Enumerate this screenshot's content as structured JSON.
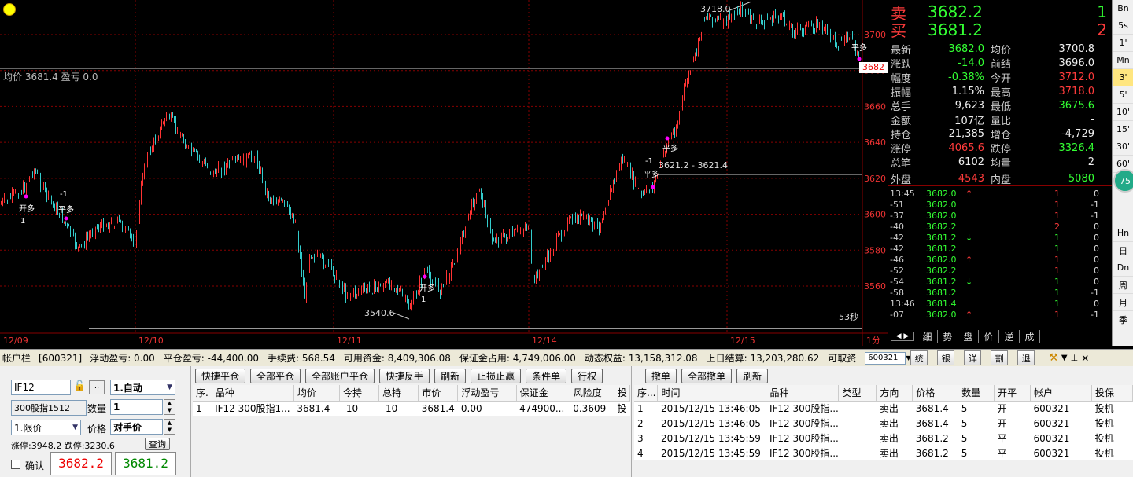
{
  "chart": {
    "price_ticks": [
      "3700",
      "3680",
      "3660",
      "3640",
      "3620",
      "3600",
      "3580",
      "3560"
    ],
    "date_ticks": [
      "12/09",
      "12/10",
      "12/11",
      "12/14",
      "12/15"
    ],
    "current_price_tag": "3682",
    "avg_label": "均价 3681.4 盈亏 0.0",
    "label_high": "3718.0",
    "label_low": "3540.6",
    "label_range": "3621.2 - 3621.4",
    "countdown": "53秒",
    "period": "1分",
    "marker_buy": "开多",
    "marker_sell": "平多",
    "marker_m1": "-1",
    "marker_p1": "1"
  },
  "quote": {
    "sell_label": "卖",
    "sell_price": "3682.2",
    "sell_qty": "1",
    "buy_label": "买",
    "buy_price": "3681.2",
    "buy_qty": "2",
    "rows": [
      {
        "l1": "最新",
        "v1": "3682.0",
        "c1": "green",
        "l2": "均价",
        "v2": "3700.8",
        "c2": "white"
      },
      {
        "l1": "涨跌",
        "v1": "-14.0",
        "c1": "green",
        "l2": "前结",
        "v2": "3696.0",
        "c2": "white"
      },
      {
        "l1": "幅度",
        "v1": "-0.38%",
        "c1": "green",
        "l2": "今开",
        "v2": "3712.0",
        "c2": "red"
      },
      {
        "l1": "振幅",
        "v1": "1.15%",
        "c1": "white",
        "l2": "最高",
        "v2": "3718.0",
        "c2": "red"
      },
      {
        "l1": "总手",
        "v1": "9,623",
        "c1": "white",
        "l2": "最低",
        "v2": "3675.6",
        "c2": "green"
      },
      {
        "l1": "金额",
        "v1": "107亿",
        "c1": "white",
        "l2": "量比",
        "v2": "-",
        "c2": "white"
      },
      {
        "l1": "持仓",
        "v1": "21,385",
        "c1": "white",
        "l2": "增仓",
        "v2": "-4,729",
        "c2": "white"
      },
      {
        "l1": "涨停",
        "v1": "4065.6",
        "c1": "red",
        "l2": "跌停",
        "v2": "3326.4",
        "c2": "green"
      },
      {
        "l1": "总笔",
        "v1": "6102",
        "c1": "white",
        "l2": "均量",
        "v2": "2",
        "c2": "white"
      }
    ],
    "outer_label": "外盘",
    "outer_val": "4543",
    "inner_label": "内盘",
    "inner_val": "5080",
    "ticks": [
      {
        "t": "13:45",
        "p": "3682.0",
        "a": "↑",
        "ac": "red",
        "q": "1",
        "qc": "red",
        "d": "0"
      },
      {
        "t": "-51",
        "p": "3682.0",
        "a": "",
        "ac": "red",
        "q": "1",
        "qc": "red",
        "d": "-1"
      },
      {
        "t": "-37",
        "p": "3682.0",
        "a": "",
        "ac": "red",
        "q": "1",
        "qc": "red",
        "d": "-1"
      },
      {
        "t": "-40",
        "p": "3682.2",
        "a": "",
        "ac": "red",
        "q": "2",
        "qc": "red",
        "d": "0"
      },
      {
        "t": "-42",
        "p": "3681.2",
        "a": "↓",
        "ac": "green",
        "q": "1",
        "qc": "green",
        "d": "0"
      },
      {
        "t": "-42",
        "p": "3681.2",
        "a": "",
        "ac": "green",
        "q": "1",
        "qc": "green",
        "d": "0"
      },
      {
        "t": "-46",
        "p": "3682.0",
        "a": "↑",
        "ac": "red",
        "q": "1",
        "qc": "red",
        "d": "0"
      },
      {
        "t": "-52",
        "p": "3682.2",
        "a": "",
        "ac": "red",
        "q": "1",
        "qc": "red",
        "d": "0"
      },
      {
        "t": "-54",
        "p": "3681.2",
        "a": "↓",
        "ac": "green",
        "q": "1",
        "qc": "green",
        "d": "0"
      },
      {
        "t": "-58",
        "p": "3681.2",
        "a": "",
        "ac": "green",
        "q": "1",
        "qc": "green",
        "d": "-1"
      },
      {
        "t": "13:46",
        "p": "3681.4",
        "a": "",
        "ac": "red",
        "q": "1",
        "qc": "green",
        "d": "0"
      },
      {
        "t": "-07",
        "p": "3682.0",
        "a": "↑",
        "ac": "red",
        "q": "1",
        "qc": "red",
        "d": "-1"
      }
    ],
    "tabs": [
      "细",
      "势",
      "盘",
      "价",
      "逆",
      "成"
    ]
  },
  "rbar": [
    "Bn",
    "5s",
    "1'",
    "Mn",
    "3'",
    "5'",
    "10'",
    "15'",
    "30'",
    "60'",
    "Hn",
    "日",
    "Dn",
    "周",
    "月",
    "季"
  ],
  "rbar_badge": "75",
  "account": {
    "label": "帐户栏",
    "id": "[600321]",
    "items": [
      "浮动盈亏: 0.00",
      "平仓盈亏: -44,400.00",
      "手续费: 568.54",
      "可用资金: 8,409,306.08",
      "保证金占用: 4,749,006.00",
      "动态权益: 13,158,312.08",
      "上日结算: 13,203,280.62",
      "可取资"
    ],
    "select": "600321",
    "btns": [
      "统",
      "银",
      "详",
      "割",
      "退"
    ]
  },
  "order": {
    "code": "IF12",
    "name": "300股指1512",
    "mode": "1.自动",
    "qty_label": "数量",
    "qty": "1",
    "type": "1.限价",
    "price_label": "价格",
    "price": "对手价",
    "query": "查询",
    "limits": "涨停:3948.2 跌停:3230.6",
    "confirm": "确认",
    "sell_price": "3682.2",
    "buy_price": "3681.2"
  },
  "pos_buttons": [
    "快捷平仓",
    "全部平仓",
    "全部账户平仓",
    "快捷反手",
    "刷新",
    "止损止赢",
    "条件单",
    "行权"
  ],
  "pos_headers": [
    "序.",
    "品种",
    "均价",
    "今持",
    "总持",
    "市价",
    "浮动盈亏",
    "保证金",
    "风险度",
    "投"
  ],
  "pos_rows": [
    [
      "1",
      "IF12 300股指1...",
      "3681.4",
      "-10",
      "-10",
      "3681.4",
      "0.00",
      "474900...",
      "0.3609",
      "投"
    ]
  ],
  "ord_buttons": [
    "撤单",
    "全部撤单",
    "刷新"
  ],
  "ord_headers": [
    "序...",
    "时间",
    "品种",
    "类型",
    "方向",
    "价格",
    "数量",
    "开平",
    "帐户",
    "投保"
  ],
  "ord_rows": [
    [
      "1",
      "2015/12/15 13:46:05",
      "IF12 300股指...",
      "",
      "卖出",
      "3681.4",
      "5",
      "开",
      "600321",
      "投机"
    ],
    [
      "2",
      "2015/12/15 13:46:05",
      "IF12 300股指...",
      "",
      "卖出",
      "3681.4",
      "5",
      "开",
      "600321",
      "投机"
    ],
    [
      "3",
      "2015/12/15 13:45:59",
      "IF12 300股指...",
      "",
      "卖出",
      "3681.2",
      "5",
      "平",
      "600321",
      "投机"
    ],
    [
      "4",
      "2015/12/15 13:45:59",
      "IF12 300股指...",
      "",
      "卖出",
      "3681.2",
      "5",
      "平",
      "600321",
      "投机"
    ]
  ]
}
